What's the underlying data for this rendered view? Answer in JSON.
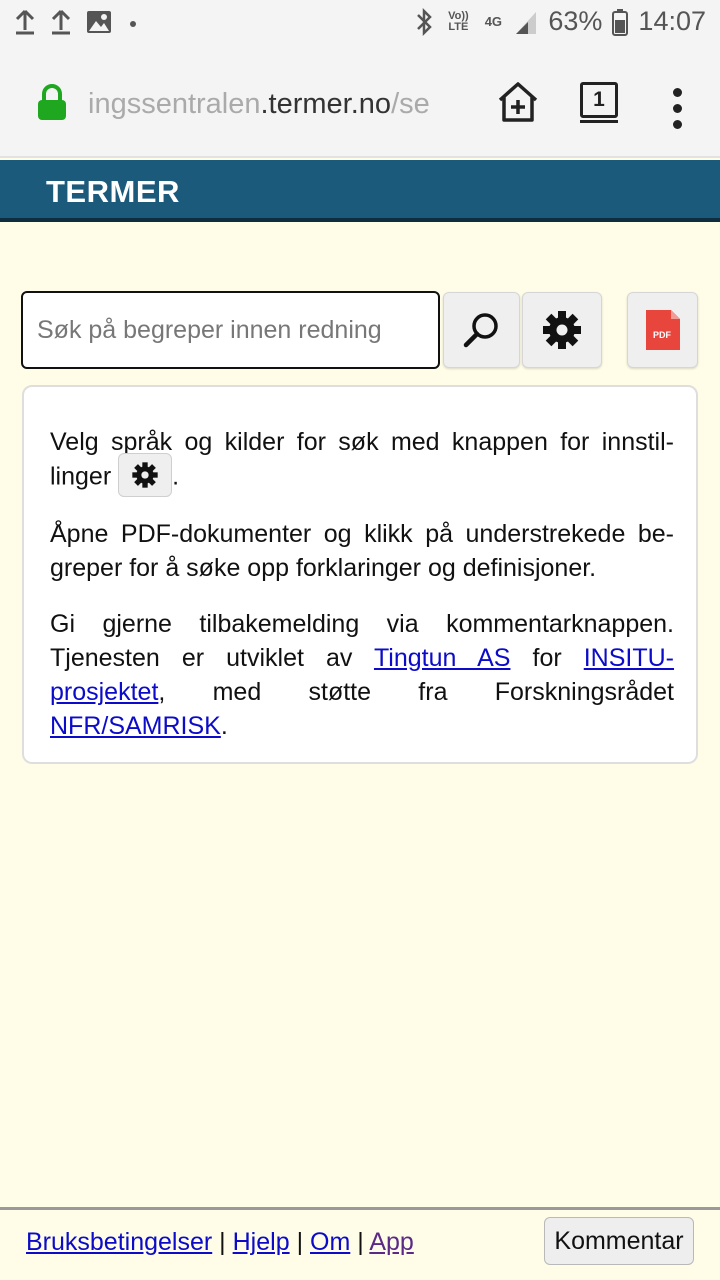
{
  "status_bar": {
    "left_icons": [
      "upload-icon",
      "upload-icon",
      "image-icon",
      "dot-icon"
    ],
    "network_label_volte": "Vo)) LTE",
    "network_label_4g": "4G",
    "battery_percent": "63%",
    "time": "14:07"
  },
  "browser": {
    "url_dim_start": "ingssentralen",
    "url_main": ".termer.no",
    "url_dim_end": "/se",
    "tab_count": "1",
    "secure": true
  },
  "header": {
    "title": "TERMER",
    "color": "#1c5a7c"
  },
  "search": {
    "placeholder": "Søk på begreper innen redning",
    "value": "",
    "pdf_label": "PDF"
  },
  "info": {
    "p1_before": "Velg språk og kilder for søk med knappen for innstil-linger",
    "p1_after": ".",
    "p2": "Åpne PDF-dokumenter og klikk på understrekede be-greper for å søke opp forklaringer og definisjoner.",
    "p3_a": "Gi gjerne tilbakemelding via kommentarknappen. Tjenesten er utviklet av ",
    "link_tingtun": "Tingtun AS",
    "p3_b": " for ",
    "link_insitu": "INSITU-prosjektet",
    "p3_c": ", med støtte fra Forskningsrådet ",
    "link_nfr": "NFR/SAMRISK",
    "p3_d": "."
  },
  "footer": {
    "links": [
      "Bruksbetingelser",
      "Hjelp",
      "Om",
      "App"
    ],
    "separator": "|",
    "comment_button": "Kommentar"
  }
}
